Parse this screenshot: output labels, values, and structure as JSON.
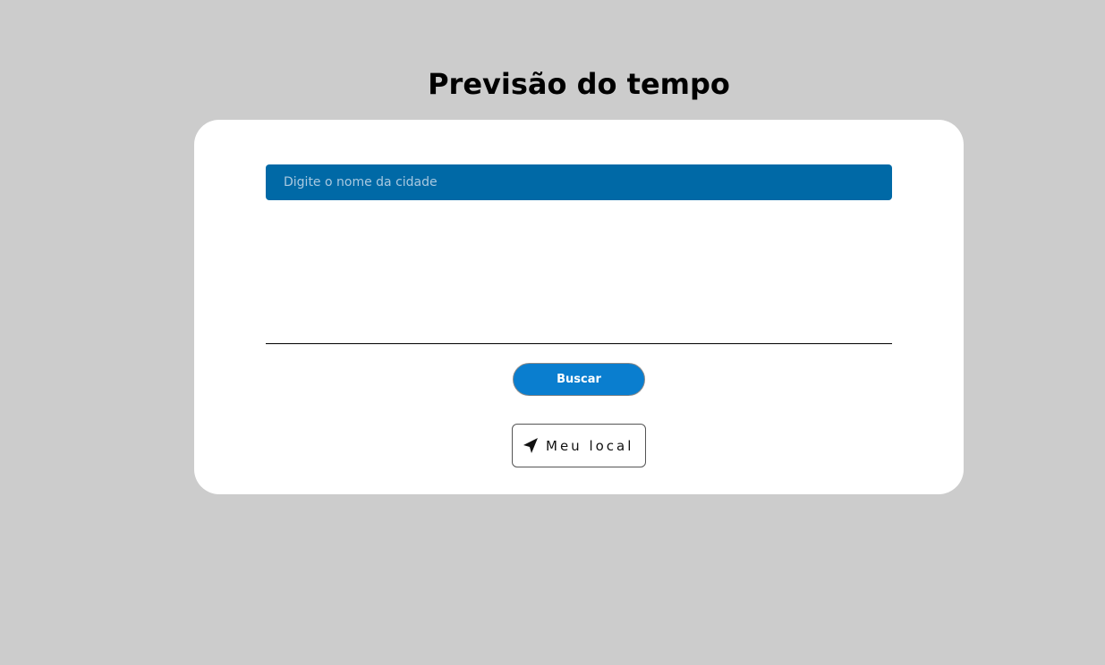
{
  "header": {
    "title": "Previsão do tempo"
  },
  "search": {
    "placeholder": "Digite o nome da cidade",
    "value": ""
  },
  "actions": {
    "search_label": "Buscar",
    "location_label": "Meu local",
    "location_icon": "navigation-arrow-icon"
  },
  "colors": {
    "background": "#cccccc",
    "card": "#ffffff",
    "input_bg": "#0069a6",
    "button_bg": "#0a7ecf"
  }
}
